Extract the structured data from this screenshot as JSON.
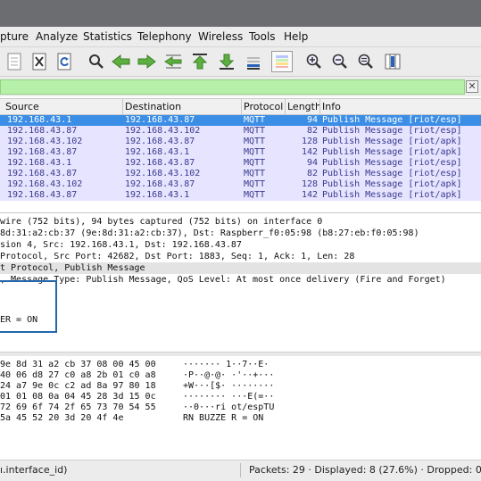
{
  "menu": {
    "items": [
      "pture",
      "Analyze",
      "Statistics",
      "Telephony",
      "Wireless",
      "Tools",
      "Help"
    ]
  },
  "toolbar": {
    "icons": [
      "document-icon",
      "close-file-icon",
      "reload-icon",
      "find-icon",
      "go-back-icon",
      "go-forward-icon",
      "go-to-packet-icon",
      "first-packet-icon",
      "last-packet-icon",
      "autoscroll-icon",
      "colorize-icon",
      "zoom-in-icon",
      "zoom-out-icon",
      "zoom-normal-icon",
      "resize-columns-icon"
    ]
  },
  "packet_list": {
    "columns": [
      "Source",
      "Destination",
      "Protocol",
      "Length",
      "Info"
    ],
    "rows": [
      {
        "source": "192.168.43.1",
        "destination": "192.168.43.87",
        "protocol": "MQTT",
        "length": "94",
        "info": "Publish Message [riot/esp]"
      },
      {
        "source": "192.168.43.87",
        "destination": "192.168.43.102",
        "protocol": "MQTT",
        "length": "82",
        "info": "Publish Message [riot/esp]"
      },
      {
        "source": "192.168.43.102",
        "destination": "192.168.43.87",
        "protocol": "MQTT",
        "length": "128",
        "info": "Publish Message [riot/apk]"
      },
      {
        "source": "192.168.43.87",
        "destination": "192.168.43.1",
        "protocol": "MQTT",
        "length": "142",
        "info": "Publish Message [riot/apk]"
      },
      {
        "source": "192.168.43.1",
        "destination": "192.168.43.87",
        "protocol": "MQTT",
        "length": "94",
        "info": "Publish Message [riot/esp]"
      },
      {
        "source": "192.168.43.87",
        "destination": "192.168.43.102",
        "protocol": "MQTT",
        "length": "82",
        "info": "Publish Message [riot/esp]"
      },
      {
        "source": "192.168.43.102",
        "destination": "192.168.43.87",
        "protocol": "MQTT",
        "length": "128",
        "info": "Publish Message [riot/apk]"
      },
      {
        "source": "192.168.43.87",
        "destination": "192.168.43.1",
        "protocol": "MQTT",
        "length": "142",
        "info": "Publish Message [riot/apk]"
      }
    ]
  },
  "details": {
    "lines": [
      "wire (752 bits), 94 bytes captured (752 bits) on interface 0",
      "8d:31:a2:cb:37 (9e:8d:31:a2:cb:37), Dst: Raspberr_f0:05:98 (b8:27:eb:f0:05:98)",
      "sion 4, Src: 192.168.43.1, Dst: 192.168.43.87",
      "Protocol, Src Port: 42682, Dst Port: 1883, Seq: 1, Ack: 1, Len: 28",
      "t Protocol, Publish Message",
      ", Message Type: Publish Message, QoS Level: At most once delivery (Fire and Forget)"
    ],
    "highlighted_value": "ER = ON"
  },
  "bytes": {
    "lines": [
      {
        "hex": "9e 8d  31 a2 cb 37 08 00 45 00",
        "ascii": "······· 1··7··E·"
      },
      {
        "hex": "40 06  d8 27 c0 a8 2b 01 c0 a8",
        "ascii": "·P··@·@·  ·'··+···"
      },
      {
        "hex": "24 a7  9e 0c c2 ad 8a 97 80 18",
        "ascii": "+W···[$·  ········"
      },
      {
        "hex": "01 01  08 0a 04 45 28 3d 15 0c",
        "ascii": "········  ···E(=··"
      },
      {
        "hex": "72 69  6f 74 2f 65 73 70 54 55",
        "ascii": "··0···ri ot/espTU"
      },
      {
        "hex": "5a 45  52 20 3d 20 4f 4e",
        "ascii": "RN BUZZE R = ON"
      }
    ]
  },
  "status": {
    "left": "ı.interface_id)",
    "right": "Packets: 29 · Displayed: 8 (27.6%) · Dropped: 0 ("
  }
}
